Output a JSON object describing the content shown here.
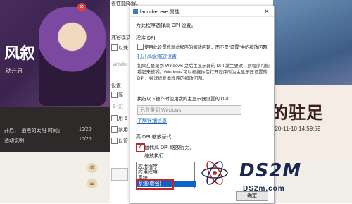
{
  "background": {
    "top_text": "省性能降解。",
    "left_banner_title": "风叙",
    "left_banner_sub": "动开启",
    "news": [
      {
        "title": "开启，「逍熊的太阳·时间」",
        "date": "10/20"
      },
      {
        "title": "活动说明",
        "date": "10/20"
      }
    ],
    "right_banner_title": "陷的驻足",
    "right_banner_date": "00~2020-11-10 14:59:59"
  },
  "dialog_back": {
    "labels": [
      "兼容模式",
      "以兼",
      "Windo",
      "设置",
      "简",
      "8 位(",
      "用 6",
      "禁用",
      "以管"
    ]
  },
  "dialog": {
    "title": "launcher.exe 属性",
    "instruction": "为此程序选择高 DPI 设置。",
    "program_dpi_heading": "程序 DPI",
    "program_dpi_checkbox": "使用此设置修复此程序的缩放问题，而不是\"设置\"中的缩放问题",
    "open_scaling_link": "打开高级缩放设置",
    "explain_text": "如果在登录到 Windows 之后主显示器的 DPI 发生更改，则程序可能看起来模糊。Windows 可以根据你在打开程序时为主显示器设置的 DPI，尝试修复此程序的缩放问题。",
    "dpi_use_label": "执行以下操作时使用我的主显示器设置的 DPI",
    "dpi_use_value": "已登录到 Windows",
    "learn_more_link": "了解详细信息",
    "override_heading": "高 DPI 缩放替代",
    "override_checkbox": "替代高 DPI 缩放行为。",
    "scaling_by_label": "缩放执行:",
    "scaling_by_value": "应用程序",
    "scaling_options": [
      "应用程序",
      "系统",
      "系统(增强)"
    ],
    "ok_label": "确定"
  },
  "watermark": {
    "logo_text": "DS2M",
    "url": "DS2m.com"
  }
}
